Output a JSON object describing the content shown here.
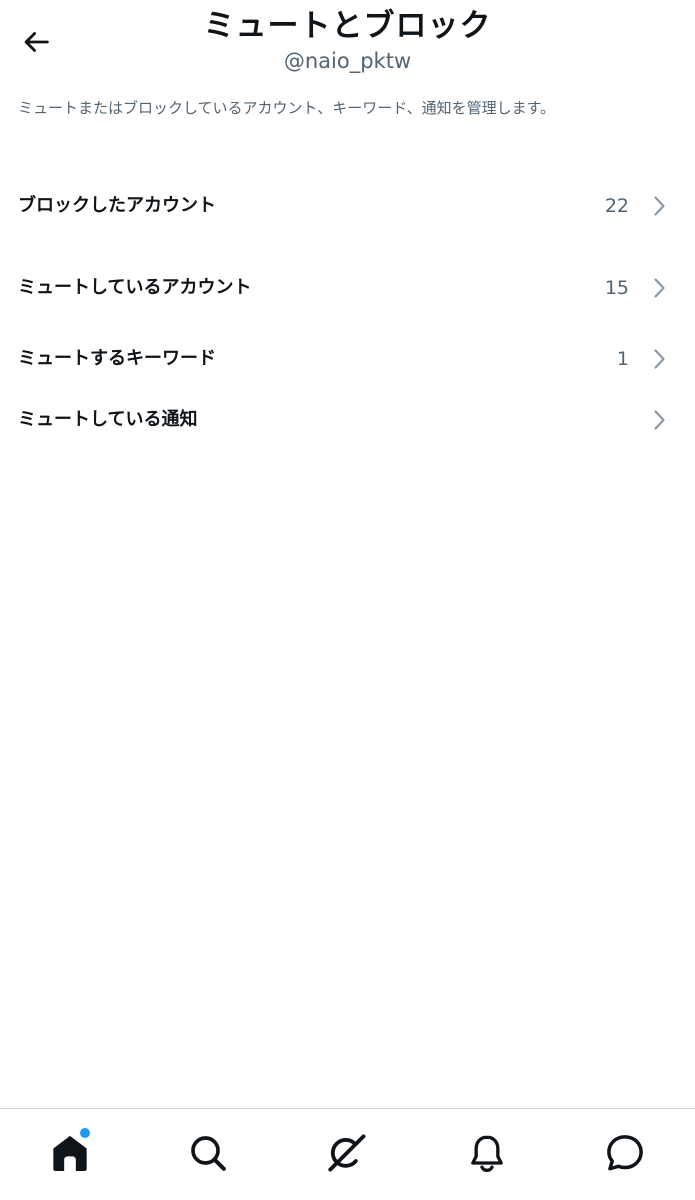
{
  "header": {
    "title": "ミュートとブロック",
    "subtitle": "@naio_pktw"
  },
  "description": "ミュートまたはブロックしているアカウント、キーワード、通知を管理します。",
  "settings": [
    {
      "label": "ブロックしたアカウント",
      "count": "22"
    },
    {
      "label": "ミュートしているアカウント",
      "count": "15"
    },
    {
      "label": "ミュートするキーワード",
      "count": "1"
    },
    {
      "label": "ミュートしている通知",
      "count": ""
    }
  ],
  "tab_bar": {
    "tabs": [
      {
        "icon": "home-icon",
        "active": true,
        "badge": true
      },
      {
        "icon": "search-icon",
        "active": false,
        "badge": false
      },
      {
        "icon": "grok-icon",
        "active": false,
        "badge": false
      },
      {
        "icon": "bell-icon",
        "active": false,
        "badge": false
      },
      {
        "icon": "messages-icon",
        "active": false,
        "badge": false
      }
    ]
  },
  "colors": {
    "text_primary": "#0f1419",
    "text_secondary": "#536471",
    "chevron": "#8b98a5",
    "badge": "#1d9bf0",
    "divider": "#d0d4d8"
  }
}
